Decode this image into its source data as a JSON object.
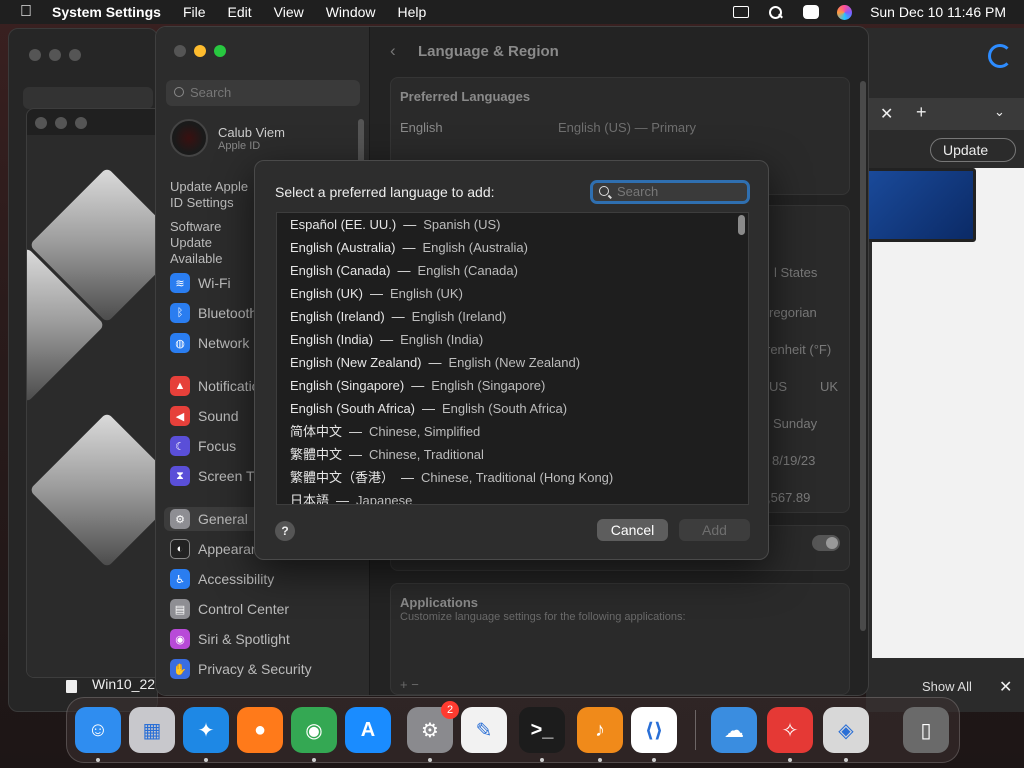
{
  "menubar": {
    "app_name": "System Settings",
    "menus": [
      "File",
      "Edit",
      "View",
      "Window",
      "Help"
    ],
    "clock": "Sun Dec 10  11:46 PM"
  },
  "background": {
    "doc_name": "Win10_22",
    "browser_update": "Update",
    "show_all": "Show All"
  },
  "sidebar": {
    "search_placeholder": "Search",
    "account_name": "Calub Viem",
    "account_sub": "Apple ID",
    "update_note": "Update Apple ID Settings",
    "software_note": "Software Update Available",
    "items": [
      {
        "label": "Wi-Fi",
        "color": "#2a7df0"
      },
      {
        "label": "Bluetooth",
        "color": "#2a7df0"
      },
      {
        "label": "Network",
        "color": "#2a7df0"
      },
      {
        "label": "Notifications",
        "color": "#e6403a"
      },
      {
        "label": "Sound",
        "color": "#e6403a"
      },
      {
        "label": "Focus",
        "color": "#5a4fd8"
      },
      {
        "label": "Screen Time",
        "color": "#5a4fd8"
      },
      {
        "label": "General",
        "color": "#8e8e93"
      },
      {
        "label": "Appearance",
        "color": "#222222"
      },
      {
        "label": "Accessibility",
        "color": "#2a7df0"
      },
      {
        "label": "Control Center",
        "color": "#8e8e93"
      },
      {
        "label": "Siri & Spotlight",
        "color": "#b84ad8"
      },
      {
        "label": "Privacy & Security",
        "color": "#3a6de0"
      }
    ]
  },
  "main": {
    "title": "Language & Region",
    "preferred_title": "Preferred Languages",
    "pref_row_name": "English",
    "pref_row_detail": "English (US) — Primary",
    "region_values": [
      "l States",
      "regorian",
      "renheit (°F)",
      "US",
      "UK",
      "Sunday",
      "8/19/23",
      ",567.89"
    ],
    "apps_title": "Applications",
    "apps_subtitle": "Customize language settings for the following applications:",
    "plus_minus": "+   −"
  },
  "dialog": {
    "title": "Select a preferred language to add:",
    "search_placeholder": "Search",
    "separator": "—",
    "languages": [
      {
        "native": "Español (EE. UU.)",
        "english": "Spanish (US)"
      },
      {
        "native": "English (Australia)",
        "english": "English (Australia)"
      },
      {
        "native": "English (Canada)",
        "english": "English (Canada)"
      },
      {
        "native": "English (UK)",
        "english": "English (UK)"
      },
      {
        "native": "English (Ireland)",
        "english": "English (Ireland)"
      },
      {
        "native": "English (India)",
        "english": "English (India)"
      },
      {
        "native": "English (New Zealand)",
        "english": "English (New Zealand)"
      },
      {
        "native": "English (Singapore)",
        "english": "English (Singapore)"
      },
      {
        "native": "English (South Africa)",
        "english": "English (South Africa)"
      },
      {
        "native": "简体中文",
        "english": "Chinese, Simplified"
      },
      {
        "native": "繁體中文",
        "english": "Chinese, Traditional"
      },
      {
        "native": "繁體中文（香港）",
        "english": "Chinese, Traditional (Hong Kong)"
      },
      {
        "native": "日本語",
        "english": "Japanese"
      }
    ],
    "help_label": "?",
    "cancel_label": "Cancel",
    "add_label": "Add"
  },
  "dock": {
    "apps": [
      {
        "name": "finder-icon",
        "glyph": "☺",
        "color": "#2f8df0"
      },
      {
        "name": "launchpad-icon",
        "glyph": "▦",
        "color": "#c8c8cc"
      },
      {
        "name": "safari-icon",
        "glyph": "✦",
        "color": "#1e88e5"
      },
      {
        "name": "firefox-icon",
        "glyph": "●",
        "color": "#ff7a1a"
      },
      {
        "name": "chrome-icon",
        "glyph": "◉",
        "color": "#34a853"
      },
      {
        "name": "app-store-icon",
        "glyph": "A",
        "color": "#1a8cff"
      },
      {
        "name": "system-settings-icon",
        "glyph": "⚙",
        "color": "#8a8a8e",
        "badge": "2"
      },
      {
        "name": "textedit-icon",
        "glyph": "✎",
        "color": "#f2f2f2"
      },
      {
        "name": "terminal-icon",
        "glyph": ">_",
        "color": "#1c1c1c"
      },
      {
        "name": "garageband-icon",
        "glyph": "♪",
        "color": "#f08a1a"
      },
      {
        "name": "vscode-icon",
        "glyph": "⟨⟩",
        "color": "#ffffff"
      },
      {
        "name": "weather-icon",
        "glyph": "☁",
        "color": "#3a8de0"
      },
      {
        "name": "compass-icon",
        "glyph": "✧",
        "color": "#e53935"
      },
      {
        "name": "disk-utility-icon",
        "glyph": "◈",
        "color": "#d8d8d8"
      },
      {
        "name": "trash-icon",
        "glyph": "▯",
        "color": "#6a6a6a"
      }
    ]
  }
}
